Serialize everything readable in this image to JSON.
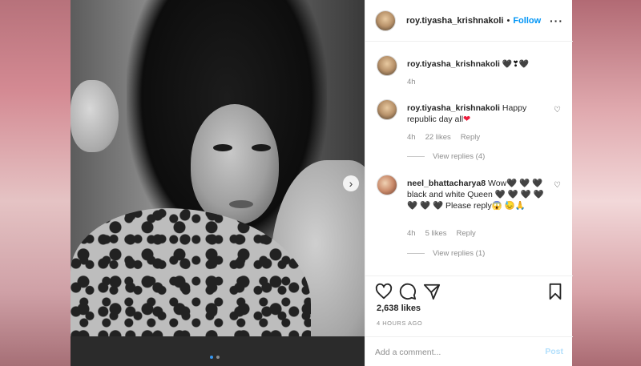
{
  "post": {
    "username": "roy.tiyasha_krishnakoli",
    "separator": "•",
    "follow_label": "Follow",
    "more_icon": "more-options-icon",
    "likes": "2,638 likes",
    "time": "4 HOURS AGO",
    "carousel": {
      "current": 1,
      "total": 2
    }
  },
  "comments": [
    {
      "username": "roy.tiyasha_krishnakoli",
      "text": "🖤❣🖤",
      "time": "4h"
    },
    {
      "username": "roy.tiyasha_krishnakoli",
      "text": "Happy republic day all",
      "emoji": "❤",
      "time": "4h",
      "likes": "22 likes",
      "reply": "Reply",
      "view_replies": "View replies (4)"
    },
    {
      "username": "neel_bhattacharya8",
      "text": "Wow🖤 🖤 🖤 black and white Queen 🖤 🖤 🖤 🖤 🖤 🖤 🖤 Please reply😱 😓🙏",
      "time": "4h",
      "likes": "5 likes",
      "reply": "Reply",
      "view_replies": "View replies (1)"
    }
  ],
  "add_comment": {
    "placeholder": "Add a comment...",
    "post_label": "Post"
  },
  "icons": {
    "like": "heart-outline-icon",
    "comment": "comment-bubble-icon",
    "share": "paper-plane-icon",
    "save": "bookmark-icon",
    "next": "chevron-right-icon"
  },
  "colors": {
    "accent": "#0095f6",
    "post_disabled": "#b2dffc",
    "muted": "#8e8e8e",
    "red_heart": "#ed1c3c"
  }
}
